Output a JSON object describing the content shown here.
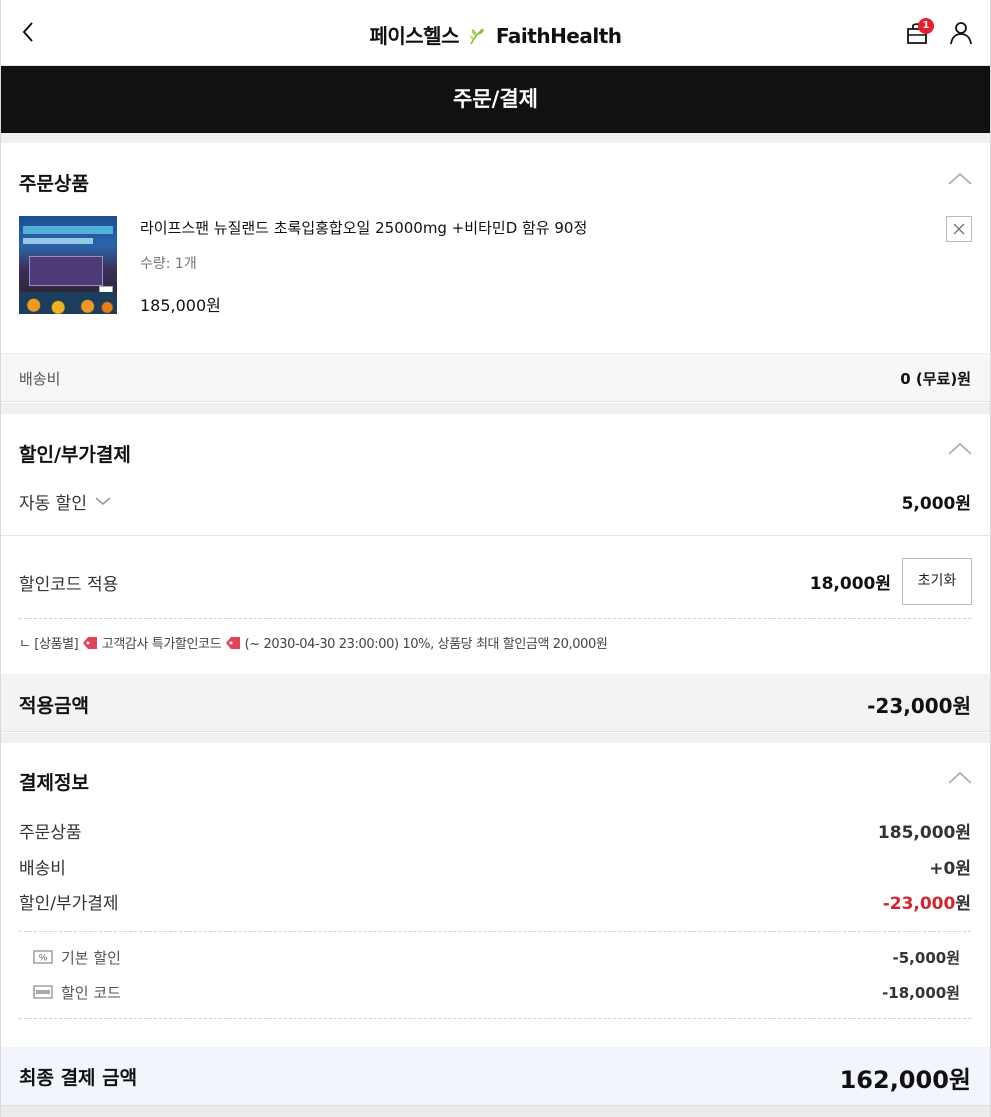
{
  "header": {
    "brand_ko": "페이스헬스",
    "brand_en": "FaithHealth",
    "cart_count": "1"
  },
  "page_title": "주문/결제",
  "order_items": {
    "title": "주문상품",
    "product": {
      "name": "라이프스팬 뉴질랜드 초록입홍합오일 25000mg +비타민D 함유 90정",
      "quantity": "수량: 1개",
      "price": "185,000원"
    },
    "shipping_label": "배송비",
    "shipping_value": "0 (무료)원"
  },
  "discount": {
    "title": "할인/부가결제",
    "auto_label": "자동 할인",
    "auto_value": "5,000원",
    "code_label": "할인코드 적용",
    "code_value": "18,000원",
    "reset_label": "초기화",
    "note_prefix": "ㄴ [상품별]",
    "note_coupon": "고객감사 특가할인코드",
    "note_suffix": "(~ 2030-04-30 23:00:00)  10%, 상품당 최대 할인금액 20,000원",
    "applied_label": "적용금액",
    "applied_value": "-23,000원"
  },
  "payment_info": {
    "title": "결제정보",
    "rows": [
      {
        "label": "주문상품",
        "value": "185,000원"
      },
      {
        "label": "배송비",
        "value": "+0원"
      },
      {
        "label": "할인/부가결제",
        "value_red": "-23,000",
        "value_unit": "원"
      }
    ],
    "sub_rows": [
      {
        "label": "기본 할인",
        "value": "-5,000원"
      },
      {
        "label": "할인 코드",
        "value": "-18,000원"
      }
    ],
    "final_label": "최종 결제 금액",
    "final_value": "162,000원"
  }
}
